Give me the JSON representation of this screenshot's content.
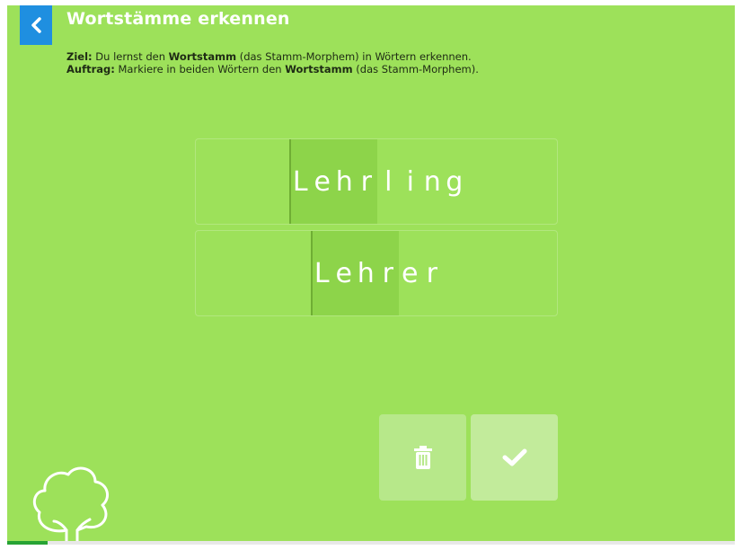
{
  "header": {
    "title": "Wortstämme erkennen"
  },
  "instructions": {
    "goal_label": "Ziel:",
    "goal_pre": " Du lernst den ",
    "goal_bold": "Wortstamm",
    "goal_post": " (das Stamm-Morphem) in Wörtern erkennen.",
    "task_label": "Auftrag:",
    "task_pre": " Markiere in beiden Wörtern den ",
    "task_bold": "Wortstamm",
    "task_post": " (das Stamm-Morphem)."
  },
  "words": [
    {
      "word": "Lehrling",
      "letters": [
        "L",
        "e",
        "h",
        "r",
        "l",
        "i",
        "n",
        "g"
      ]
    },
    {
      "word": "Lehrer",
      "letters": [
        "L",
        "e",
        "h",
        "r",
        "e",
        "r"
      ]
    }
  ],
  "buttons": {
    "delete_icon": "trash-icon",
    "check_icon": "checkmark-icon",
    "back_icon": "chevron-left-icon"
  },
  "decor": {
    "tree_icon": "tree-outline-icon"
  },
  "progress": {
    "fraction": 0.055
  },
  "colors": {
    "background": "#9de15a",
    "highlight": "#8dd44a",
    "back_button": "#1f8fe0",
    "progress": "#27a334"
  }
}
